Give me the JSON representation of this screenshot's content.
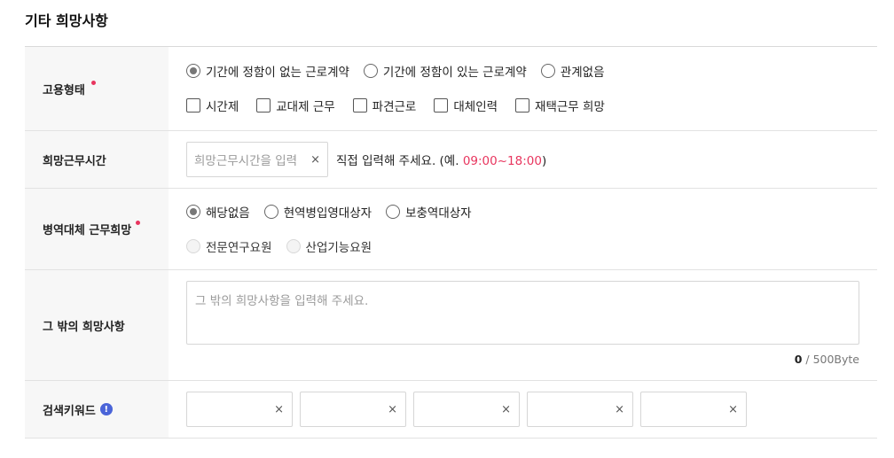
{
  "section": {
    "title": "기타 희망사항"
  },
  "employment": {
    "label": "고용형태",
    "radios": [
      "기간에 정함이 없는 근로계약",
      "기간에 정함이 있는 근로계약",
      "관계없음"
    ],
    "checkboxes": [
      "시간제",
      "교대제 근무",
      "파견근로",
      "대체인력",
      "재택근무 희망"
    ]
  },
  "work_hours": {
    "label": "희망근무시간",
    "placeholder": "희망근무시간을 입력",
    "clear": "×",
    "hint": "직접 입력해 주세요. (예.",
    "example": "09:00~18:00",
    "hint_end": ")"
  },
  "military": {
    "label": "병역대체 근무희망",
    "options_row1": [
      "해당없음",
      "현역병입영대상자",
      "보충역대상자"
    ],
    "options_row2": [
      "전문연구요원",
      "산업기능요원"
    ]
  },
  "other": {
    "label": "그 밖의 희망사항",
    "placeholder": "그 밖의 희망사항을 입력해 주세요.",
    "count": "0",
    "limit": "/ 500Byte"
  },
  "keywords": {
    "label": "검색키워드",
    "info": "!",
    "clear": "×"
  },
  "colors": {
    "required": "#e8355e",
    "info": "#4a64d8"
  }
}
